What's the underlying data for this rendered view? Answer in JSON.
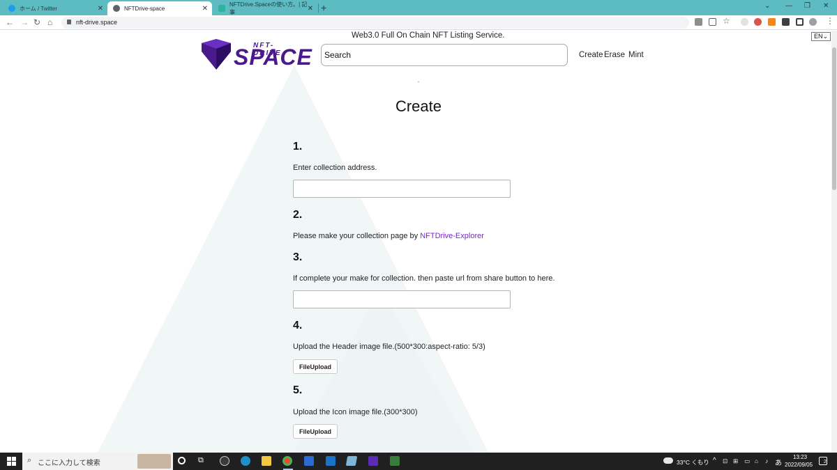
{
  "browser": {
    "tabs": [
      {
        "title": "ホーム / Twitter",
        "active": false,
        "favicon_color": "#1d9bf0"
      },
      {
        "title": "NFTDrive-space",
        "active": true,
        "favicon_color": "#5f6368"
      },
      {
        "title": "NFTDrive.Spaceの使い方。| 記事",
        "active": false,
        "favicon_color": "#2fb39a"
      }
    ],
    "new_tab_glyph": "+",
    "url": "nft-drive.space"
  },
  "header": {
    "tagline": "Web3.0 Full On Chain NFT Listing Service.",
    "language": "EN",
    "logo_top_text": "NFT-DRIVE",
    "logo_main_text": "SPACE",
    "search_placeholder": "Search",
    "nav": [
      "Create",
      "Erase",
      "Mint"
    ]
  },
  "main": {
    "title": "Create",
    "steps": [
      {
        "number": "1.",
        "text": "Enter collection address."
      },
      {
        "number": "2.",
        "text": "Please make your collection page by ",
        "link": "NFTDrive-Explorer"
      },
      {
        "number": "3.",
        "text": "If complete your make for collection. then paste url from share button to here."
      },
      {
        "number": "4.",
        "text": "Upload the Header image file.(500*300:aspect-ratio: 5/3)",
        "button": "FileUpload"
      },
      {
        "number": "5.",
        "text": "Upload the Icon image file.(300*300)",
        "button": "FileUpload"
      }
    ]
  },
  "taskbar": {
    "search_placeholder": "ここに入力して検索",
    "weather": "33°C くもり",
    "ime": "あ",
    "time": "13:23",
    "date": "2022/09/05",
    "notification_count": "2"
  },
  "colors": {
    "tabbar": "#5dbbc2",
    "link": "#7928ca",
    "logo_purple": "#4a1a8c",
    "taskbar": "#202020"
  }
}
